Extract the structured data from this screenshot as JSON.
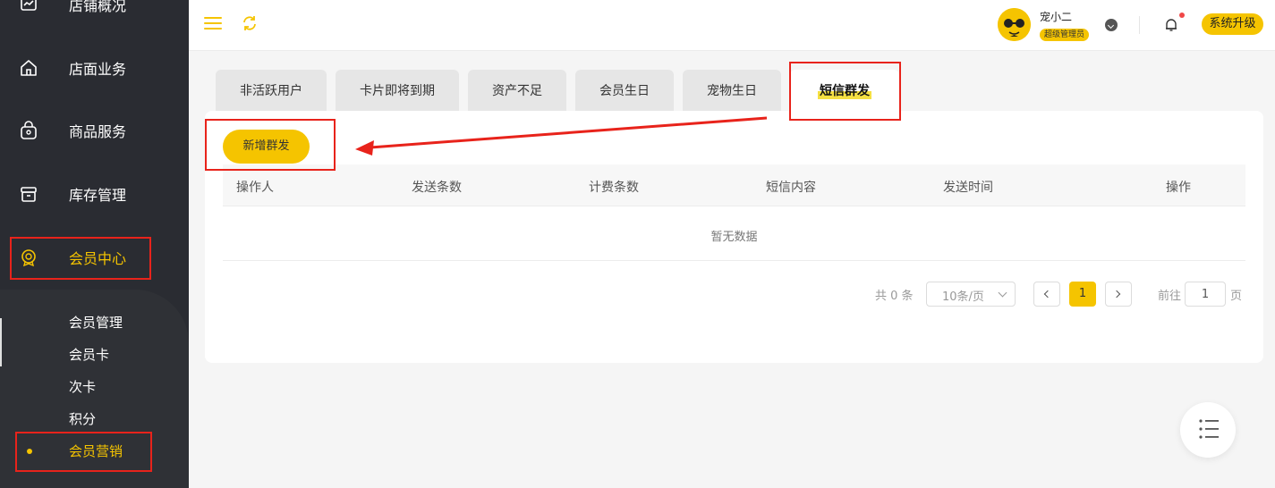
{
  "sidebar": {
    "items": [
      {
        "label": "店铺概况",
        "icon": "chart-board-icon"
      },
      {
        "label": "店面业务",
        "icon": "home-icon"
      },
      {
        "label": "商品服务",
        "icon": "shopping-bag-icon"
      },
      {
        "label": "库存管理",
        "icon": "inventory-box-icon"
      },
      {
        "label": "会员中心",
        "icon": "member-badge-icon"
      }
    ],
    "subitems": [
      {
        "label": "会员管理"
      },
      {
        "label": "会员卡"
      },
      {
        "label": "次卡"
      },
      {
        "label": "积分"
      },
      {
        "label": "会员营销"
      }
    ]
  },
  "header": {
    "username": "宠小二",
    "role": "超级管理员",
    "upgrade_label": "系统升级"
  },
  "tabs": [
    {
      "label": "非活跃用户"
    },
    {
      "label": "卡片即将到期"
    },
    {
      "label": "资产不足"
    },
    {
      "label": "会员生日"
    },
    {
      "label": "宠物生日"
    },
    {
      "label": "短信群发"
    }
  ],
  "main": {
    "add_button": "新增群发",
    "columns": [
      "操作人",
      "发送条数",
      "计费条数",
      "短信内容",
      "发送时间",
      "操作"
    ],
    "empty_text": "暂无数据"
  },
  "pagination": {
    "total": "共 0 条",
    "page_size": "10条/页",
    "current_page": "1",
    "goto_label": "前往",
    "goto_value": "1",
    "goto_suffix": "页"
  },
  "colors": {
    "accent": "#f5c400",
    "sidebar_bg": "#2a2c32",
    "annotation": "#e8231b"
  }
}
